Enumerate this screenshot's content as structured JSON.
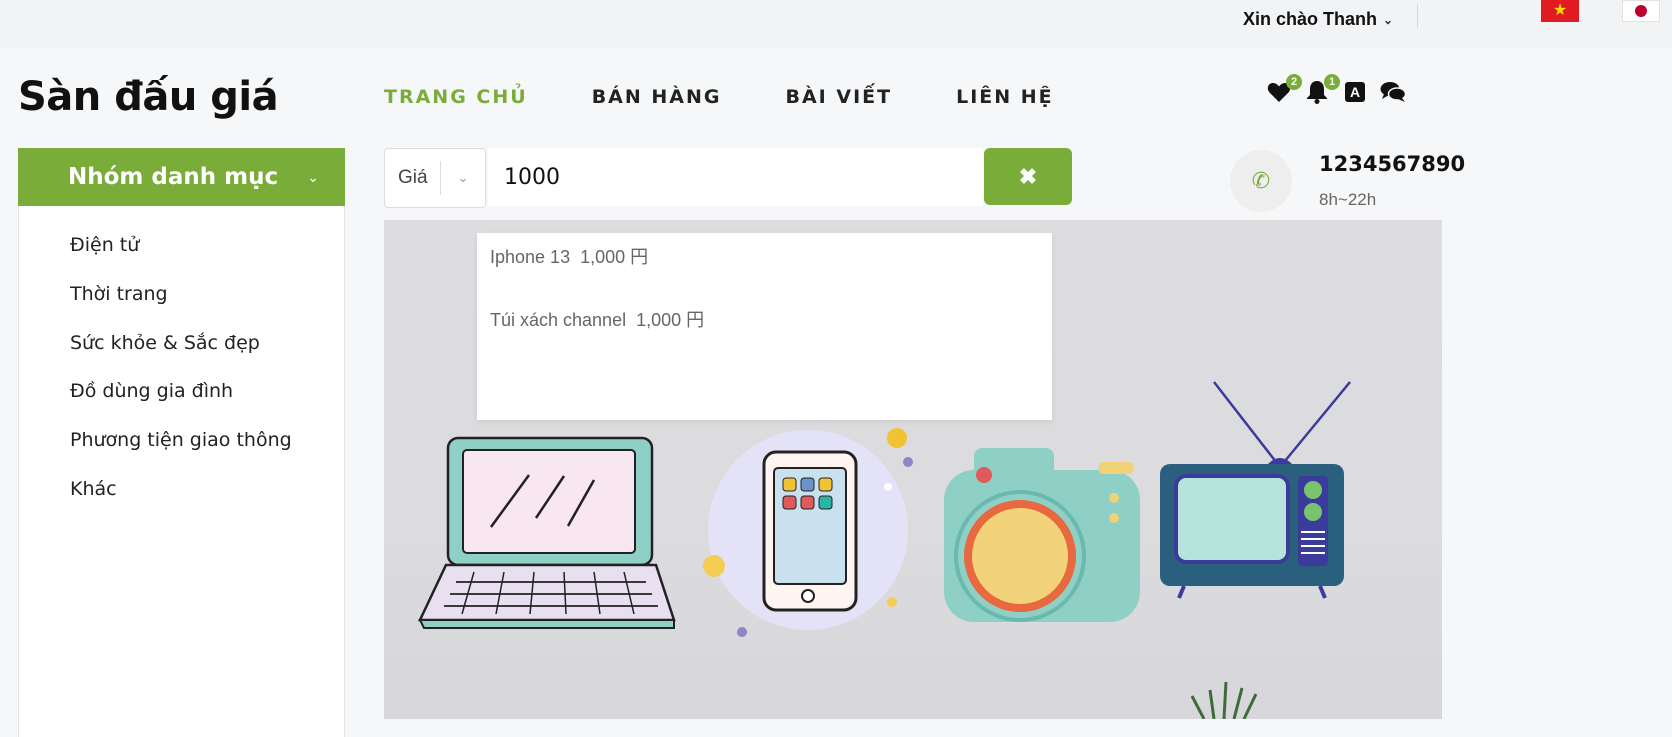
{
  "header": {
    "greeting": "Xin chào Thanh",
    "languages": [
      "vi",
      "ja"
    ]
  },
  "site_title": "Sàn đấu giá",
  "nav": {
    "items": [
      {
        "label": "TRANG CHỦ",
        "active": true
      },
      {
        "label": "BÁN HÀNG",
        "active": false
      },
      {
        "label": "BÀI VIẾT",
        "active": false
      },
      {
        "label": "LIÊN HỆ",
        "active": false
      }
    ]
  },
  "header_icons": {
    "favorites_count": "2",
    "notifications_count": "1"
  },
  "categories": {
    "title": "Nhóm danh mục",
    "items": [
      "Điện tử",
      "Thời trang",
      "Sức khỏe & Sắc đẹp",
      "Đồ dùng gia đình",
      "Phương tiện giao thông",
      "Khác"
    ]
  },
  "search": {
    "type_label": "Giá",
    "value": "1000"
  },
  "contact": {
    "phone": "1234567890",
    "hours": "8h~22h"
  },
  "suggestions": [
    {
      "name": "Iphone 13",
      "price": "1,000 円"
    },
    {
      "name": "Túi xách channel",
      "price": "1,000 円"
    }
  ],
  "colors": {
    "accent": "#7aac3a"
  }
}
